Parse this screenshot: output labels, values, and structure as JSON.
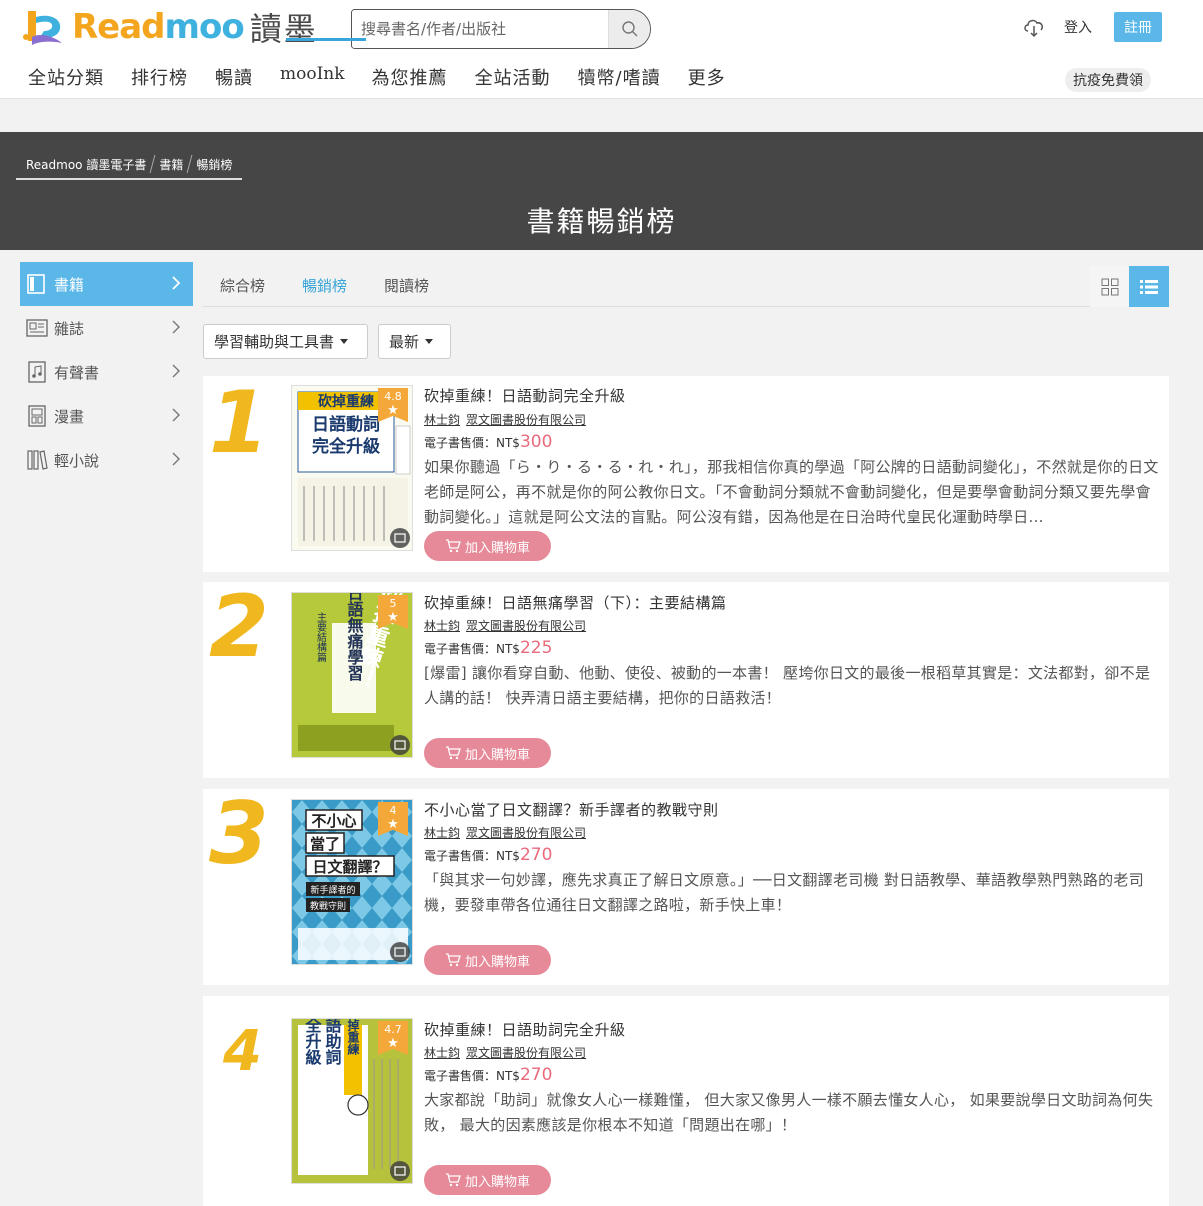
{
  "header": {
    "logo_word_1": "Read",
    "logo_word_2": "moo",
    "logo_zh": "讀墨",
    "search_placeholder": "搜尋書名/作者/出版社",
    "login": "登入",
    "register": "註冊",
    "free_button": "抗疫免費領"
  },
  "nav": {
    "items": [
      "全站分類",
      "排行榜",
      "暢讀",
      "mooInk",
      "為您推薦",
      "全站活動",
      "犢幣/嗜讀",
      "更多"
    ]
  },
  "banner": {
    "breadcrumb": [
      "Readmoo 讀墨電子書",
      "書籍",
      "暢銷榜"
    ],
    "title": "書籍暢銷榜"
  },
  "sidebar": {
    "items": [
      {
        "label": "書籍",
        "icon": "book-icon"
      },
      {
        "label": "雜誌",
        "icon": "magazine-icon"
      },
      {
        "label": "有聲書",
        "icon": "audiobook-icon"
      },
      {
        "label": "漫畫",
        "icon": "comic-icon"
      },
      {
        "label": "輕小說",
        "icon": "light-novel-icon"
      }
    ]
  },
  "tabs": [
    "綜合榜",
    "暢銷榜",
    "閱讀榜"
  ],
  "filters": {
    "category": "學習輔助與工具書",
    "sort": "最新"
  },
  "price_label": "電子書售價：NT$",
  "cart_label": "加入購物車",
  "books": [
    {
      "rank": "1",
      "rating": "4.8",
      "title": "砍掉重練！日語動詞完全升級",
      "author": "林士鈞",
      "publisher": "眾文圖書股份有限公司",
      "price": "300",
      "desc": "如果你聽過「ら・り・る・る・れ・れ」，那我相信你真的學過「阿公牌的日語動詞變化」，不然就是你的日文老師是阿公，再不就是你的阿公教你日文。「不會動詞分類就不會動詞變化，但是要學會動詞分類又要先學會動詞變化。」這就是阿公文法的盲點。阿公沒有錯，因為他是在日治時代皇民化運動時學日...",
      "cover_text_1": "砍掉重練",
      "cover_text_2": "日語動詞",
      "cover_text_3": "完全升級"
    },
    {
      "rank": "2",
      "rating": "5",
      "title": "砍掉重練！日語無痛學習（下）：主要結構篇",
      "author": "林士鈞",
      "publisher": "眾文圖書股份有限公司",
      "price": "225",
      "desc": "[爆雷] 讓你看穿自動、他動、使役、被動的一本書！ 壓垮你日文的最後一根稻草其實是：文法都對，卻不是人講的話！ 快弄清日語主要結構，把你的日語救活！",
      "cover_text_1": "砍掉重練！",
      "cover_text_2": "日語無痛學習",
      "cover_text_3": "主要結構篇"
    },
    {
      "rank": "3",
      "rating": "4",
      "title": "不小心當了日文翻譯？新手譯者的教戰守則",
      "author": "林士鈞",
      "publisher": "眾文圖書股份有限公司",
      "price": "270",
      "desc": "「與其求一句妙譯，應先求真正了解日文原意。」──日文翻譯老司機 對日語教學、華語教學熟門熟路的老司機，要發車帶各位通往日文翻譯之路啦，新手快上車！",
      "cover_text_1": "不小心",
      "cover_text_2": "當了",
      "cover_text_3": "日文翻譯？",
      "cover_text_4": "新手譯者的",
      "cover_text_5": "教戰守則"
    },
    {
      "rank": "4",
      "rating": "4.7",
      "title": "砍掉重練！日語助詞完全升級",
      "author": "林士鈞",
      "publisher": "眾文圖書股份有限公司",
      "price": "270",
      "desc": "大家都說「助詞」就像女人心一樣難懂， 但大家又像男人一樣不願去懂女人心， 如果要說學日文助詞為何失敗， 最大的因素應該是你根本不知道「問題出在哪」！",
      "cover_text_1": "完全升級",
      "cover_text_2": "日語助詞",
      "cover_text_3": "砍掉重練"
    }
  ]
}
